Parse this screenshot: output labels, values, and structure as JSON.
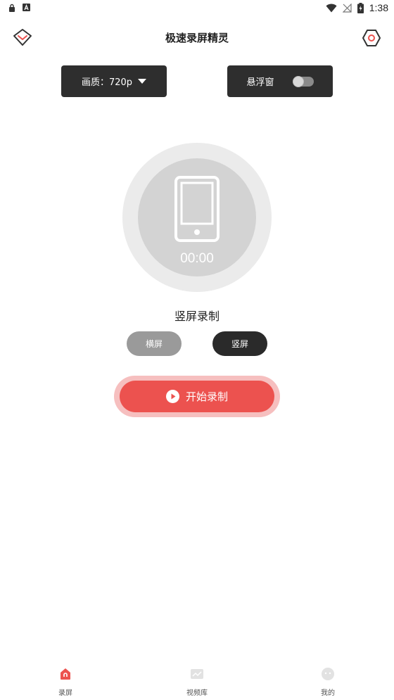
{
  "status_bar": {
    "time": "1:38"
  },
  "header": {
    "title": "极速录屏精灵"
  },
  "controls": {
    "quality_label": "画质：720p",
    "floating_window_label": "悬浮窗",
    "floating_window_on": false
  },
  "recorder": {
    "timer": "00:00",
    "mode_label": "竖屏录制",
    "orientation_options": [
      "横屏",
      "竖屏"
    ],
    "selected_orientation": "竖屏",
    "start_label": "开始录制"
  },
  "bottom_nav": {
    "items": [
      {
        "label": "录屏",
        "icon": "home-icon",
        "active": true
      },
      {
        "label": "视频库",
        "icon": "video-library-icon",
        "active": false
      },
      {
        "label": "我的",
        "icon": "profile-icon",
        "active": false
      }
    ]
  },
  "colors": {
    "accent": "#ec524f",
    "accent_ring": "#f6bfbf",
    "dark": "#2e2e2e",
    "pill_inactive": "#9a9a9a"
  }
}
